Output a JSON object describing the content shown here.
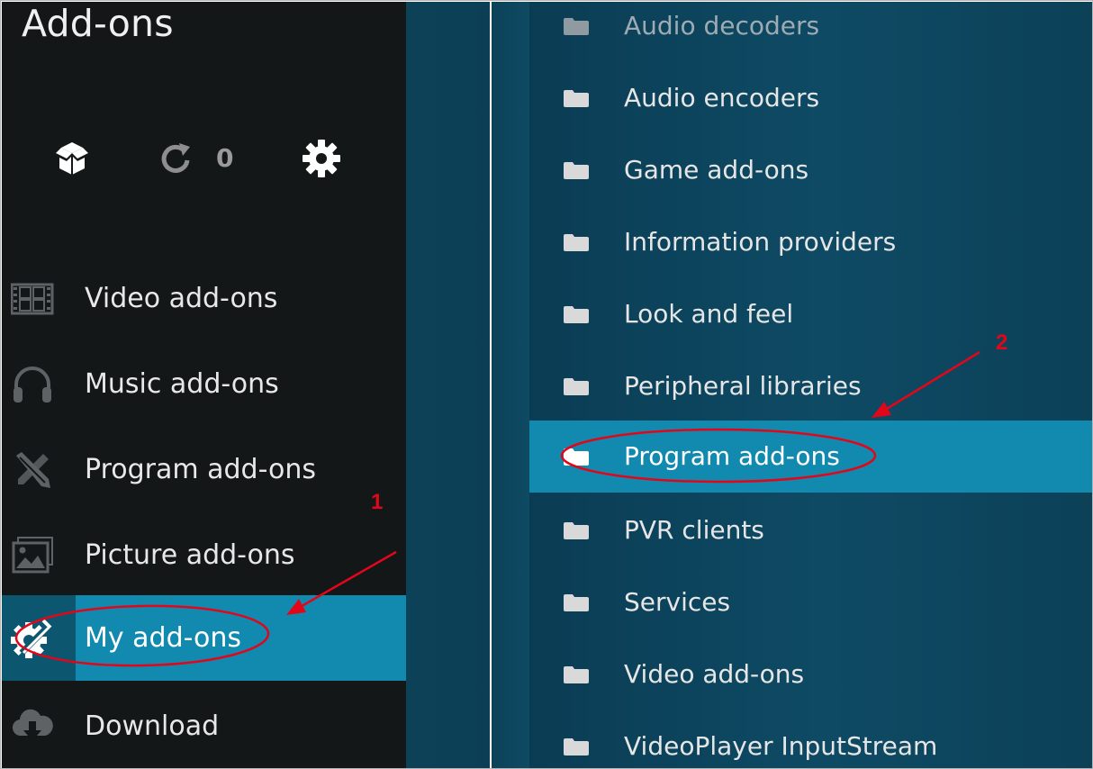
{
  "header": {
    "title": "Add-ons"
  },
  "toolbar": {
    "installed_icon": "open-box-icon",
    "update_icon": "refresh-icon",
    "update_count": "0",
    "settings_icon": "gear-icon"
  },
  "sidebar": {
    "items": [
      {
        "label": "Video add-ons",
        "icon": "film-strip-icon"
      },
      {
        "label": "Music add-ons",
        "icon": "headphones-icon"
      },
      {
        "label": "Program add-ons",
        "icon": "pencil-tools-icon"
      },
      {
        "label": "Picture add-ons",
        "icon": "picture-icon"
      },
      {
        "label": "My add-ons",
        "icon": "settings-tools-icon",
        "selected": true
      },
      {
        "label": "Download",
        "icon": "cloud-download-icon"
      }
    ]
  },
  "categories": {
    "items": [
      {
        "label": "Audio decoders"
      },
      {
        "label": "Audio encoders"
      },
      {
        "label": "Game add-ons"
      },
      {
        "label": "Information providers"
      },
      {
        "label": "Look and feel"
      },
      {
        "label": "Peripheral libraries"
      },
      {
        "label": "Program add-ons",
        "selected": true
      },
      {
        "label": "PVR clients"
      },
      {
        "label": "Services"
      },
      {
        "label": "Video add-ons"
      },
      {
        "label": "VideoPlayer InputStream"
      }
    ]
  },
  "annotations": {
    "marker_1": "1",
    "marker_2": "2",
    "color": "#e2061b"
  },
  "theme": {
    "accent": "#1289ae",
    "sidebar_bg": "#141718",
    "panel_bg": "#0e4a64"
  }
}
